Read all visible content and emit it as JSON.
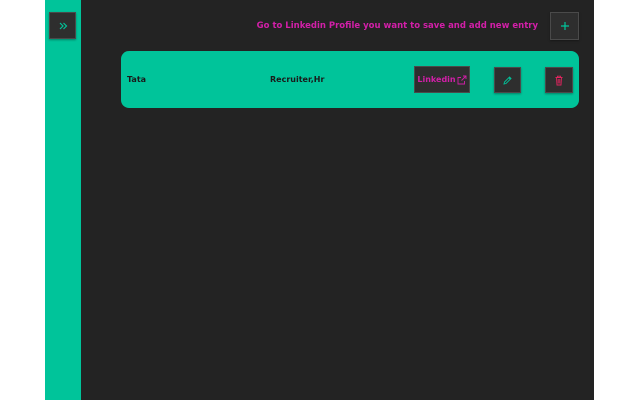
{
  "header": {
    "hint_text": "Go to Linkedin Profile you want to save and add new entry"
  },
  "sidebar": {
    "expand_icon": "chevron-double-right-icon"
  },
  "entries": [
    {
      "name": "Tata",
      "role": "Recruiter,Hr",
      "linkedin_label": "Linkedin"
    }
  ],
  "colors": {
    "accent": "#00c49a",
    "background": "#232323",
    "highlight": "#d21fa8",
    "delete": "#e0245e"
  }
}
